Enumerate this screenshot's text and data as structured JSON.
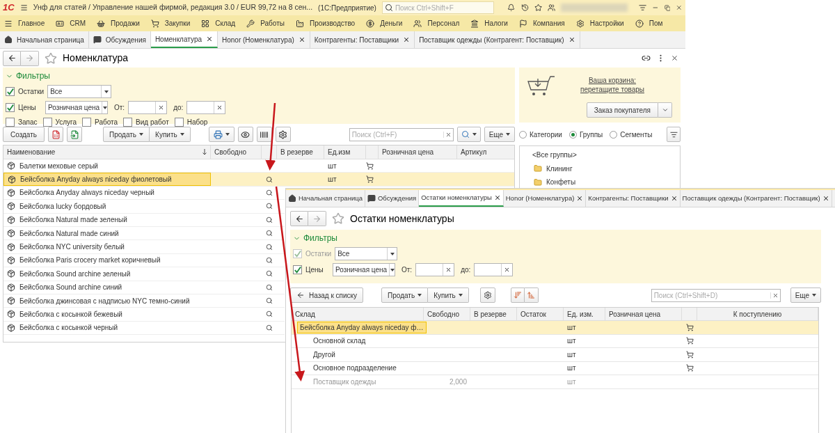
{
  "app_bar": {
    "logo": "1С",
    "title": "Унф для статей / Управление нашей фирмой, редакция 3.0 / EUR 99,72 на 8 сен...",
    "suffix": "(1С:Предприятие)",
    "search_placeholder": "Поиск Ctrl+Shift+F"
  },
  "sections": [
    {
      "label": "Главное"
    },
    {
      "label": "CRM"
    },
    {
      "label": "Продажи"
    },
    {
      "label": "Закупки"
    },
    {
      "label": "Склад"
    },
    {
      "label": "Работы"
    },
    {
      "label": "Производство"
    },
    {
      "label": "Деньги"
    },
    {
      "label": "Персонал"
    },
    {
      "label": "Налоги"
    },
    {
      "label": "Компания"
    },
    {
      "label": "Настройки"
    },
    {
      "label": "Пом"
    }
  ],
  "tabs": [
    {
      "label": "Начальная страница",
      "selected": false,
      "closable": false
    },
    {
      "label": "Обсуждения",
      "selected": false,
      "closable": false
    },
    {
      "label": "Номенклатура",
      "selected": true,
      "closable": true
    },
    {
      "label": "Honor (Номенклатура)",
      "selected": false,
      "closable": true
    },
    {
      "label": "Контрагенты: Поставщики",
      "selected": false,
      "closable": true
    },
    {
      "label": "Поставщик одежды (Контрагент: Поставщик)",
      "selected": false,
      "closable": true
    }
  ],
  "page": {
    "title": "Номенклатура",
    "filters": {
      "heading": "Фильтры",
      "stock": {
        "label": "Остатки",
        "checked": true,
        "value": "Все"
      },
      "prices": {
        "label": "Цены",
        "checked": true,
        "value": "Розничная цена",
        "from_label": "От:",
        "to_label": "до:"
      },
      "types": [
        {
          "label": "Запас",
          "checked": false
        },
        {
          "label": "Услуга",
          "checked": false
        },
        {
          "label": "Работа",
          "checked": false
        },
        {
          "label": "Вид работ",
          "checked": false
        },
        {
          "label": "Набор",
          "checked": false
        }
      ]
    },
    "toolbar": {
      "create": "Создать",
      "sell": "Продать",
      "buy": "Купить",
      "search_placeholder": "Поиск (Ctrl+F)",
      "more": "Еще"
    },
    "table": {
      "columns": [
        "Наименование",
        "Свободно",
        "В резерве",
        "Ед.изм",
        "Розничная цена",
        "Артикул"
      ],
      "rows": [
        {
          "name": "Балетки меховые серый",
          "selected": false,
          "unit": "шт",
          "cart": true,
          "lookup": false
        },
        {
          "name": "Бейсболка Anyday always niceday фиолетовый",
          "selected": true,
          "unit": "шт",
          "cart": true,
          "lookup": true
        },
        {
          "name": "Бейсболка Anyday always niceday черный",
          "selected": false,
          "lookup": true
        },
        {
          "name": "Бейсболка lucky бордовый",
          "selected": false,
          "lookup": true
        },
        {
          "name": "Бейсболка Natural made зеленый",
          "selected": false,
          "lookup": true
        },
        {
          "name": "Бейсболка Natural made синий",
          "selected": false,
          "lookup": true
        },
        {
          "name": "Бейсболка NYC university белый",
          "selected": false,
          "lookup": true
        },
        {
          "name": "Бейсболка Paris crocery market коричневый",
          "selected": false,
          "lookup": true
        },
        {
          "name": "Бейсболка Sound archine зеленый",
          "selected": false,
          "lookup": true
        },
        {
          "name": "Бейсболка Sound archine синий",
          "selected": false,
          "lookup": true
        },
        {
          "name": "Бейсболка джинсовая с надписью NYC темно-синий",
          "selected": false,
          "lookup": true
        },
        {
          "name": "Бейсболка с косынкой бежевый",
          "selected": false,
          "lookup": true
        },
        {
          "name": "Бейсболка с косынкой черный",
          "selected": false,
          "lookup": true
        }
      ]
    },
    "side": {
      "basket_link": "Ваша корзина: перетащите товары",
      "order_button": "Заказ покупателя",
      "modes": [
        {
          "label": "Категории",
          "selected": false
        },
        {
          "label": "Группы",
          "selected": true
        },
        {
          "label": "Сегменты",
          "selected": false
        }
      ],
      "groups": [
        {
          "label": "<Все группы>",
          "kind": "all"
        },
        {
          "label": "Клининг",
          "kind": "folder"
        },
        {
          "label": "Конфеты",
          "kind": "folder"
        }
      ]
    }
  },
  "overlay": {
    "tabs": [
      {
        "label": "Начальная страница",
        "selected": false,
        "closable": false
      },
      {
        "label": "Обсуждения",
        "selected": false,
        "closable": false
      },
      {
        "label": "Остатки номенклатуры",
        "selected": true,
        "closable": true
      },
      {
        "label": "Honor (Номенклатура)",
        "selected": false,
        "closable": true
      },
      {
        "label": "Контрагенты: Поставщики",
        "selected": false,
        "closable": true
      },
      {
        "label": "Поставщик одежды (Контрагент: Поставщик)",
        "selected": false,
        "closable": true
      }
    ],
    "title": "Остатки номенклатуры",
    "filters": {
      "heading": "Фильтры",
      "stock": {
        "label": "Остатки",
        "checked": true,
        "disabled": true,
        "value": "Все"
      },
      "prices": {
        "label": "Цены",
        "checked": true,
        "value": "Розничная цена",
        "from_label": "От:",
        "to_label": "до:"
      }
    },
    "toolbar": {
      "back": "Назад к списку",
      "sell": "Продать",
      "buy": "Купить",
      "search_placeholder": "Поиск (Ctrl+Shift+D)",
      "more": "Еще"
    },
    "table": {
      "columns": [
        "Склад",
        "Свободно",
        "В резерве",
        "Остаток",
        "Ед. изм.",
        "Розничная цена",
        "К поступлению"
      ],
      "rows": [
        {
          "name": "Бейсболка Anyday always niceday ф…",
          "kind": "group",
          "selected": true,
          "unit": "шт",
          "cart": true
        },
        {
          "name": "Основной склад",
          "kind": "item",
          "selected": false,
          "unit": "шт",
          "cart": true
        },
        {
          "name": "Другой",
          "kind": "item",
          "selected": false,
          "unit": "шт",
          "cart": true
        },
        {
          "name": "Основное подразделение",
          "kind": "item",
          "selected": false,
          "unit": "шт",
          "cart": true
        },
        {
          "name": "Поставщик одежды",
          "kind": "supplier",
          "selected": false,
          "free": "2,000",
          "unit": "шт",
          "cart": false
        }
      ]
    }
  }
}
